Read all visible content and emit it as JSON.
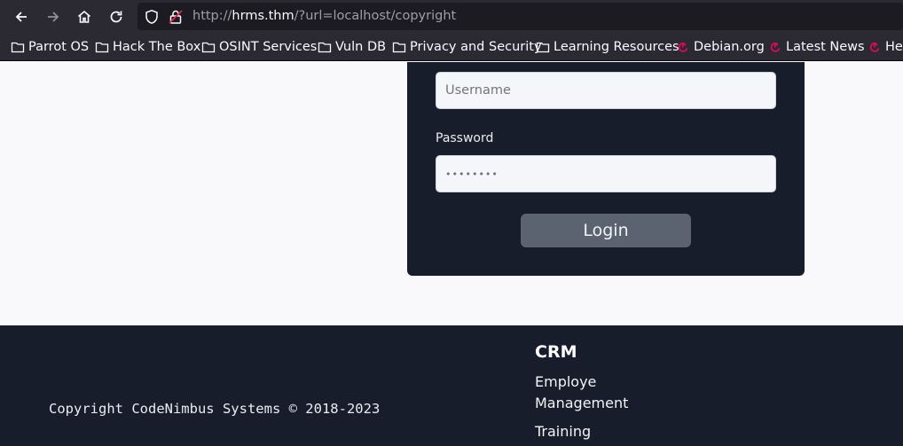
{
  "browser": {
    "url_prefix": "http://",
    "url_host": "hrms.thm",
    "url_rest": "/?url=localhost/copyright",
    "bookmarks": [
      {
        "label": "Parrot OS",
        "icon": "folder-icon"
      },
      {
        "label": "Hack The Box",
        "icon": "folder-icon"
      },
      {
        "label": "OSINT Services",
        "icon": "folder-icon"
      },
      {
        "label": "Vuln DB",
        "icon": "folder-icon"
      },
      {
        "label": "Privacy and Security",
        "icon": "folder-icon"
      },
      {
        "label": "Learning Resources",
        "icon": "folder-icon"
      },
      {
        "label": "Debian.org",
        "icon": "debian-icon"
      },
      {
        "label": "Latest News",
        "icon": "debian-icon"
      },
      {
        "label": "He",
        "icon": "debian-icon"
      }
    ]
  },
  "login": {
    "username_placeholder": "Username",
    "password_label": "Password",
    "password_value": "••••••••",
    "login_label": "Login"
  },
  "footer": {
    "copyright": "Copyright CodeNimbus Systems © 2018-2023",
    "crm_title": "CRM",
    "links": [
      "Employe",
      "Management",
      "Training"
    ]
  },
  "colors": {
    "toolbar": "#2b2a33",
    "card": "#171d2b",
    "button": "#5c6370",
    "debian": "#d70a53"
  }
}
